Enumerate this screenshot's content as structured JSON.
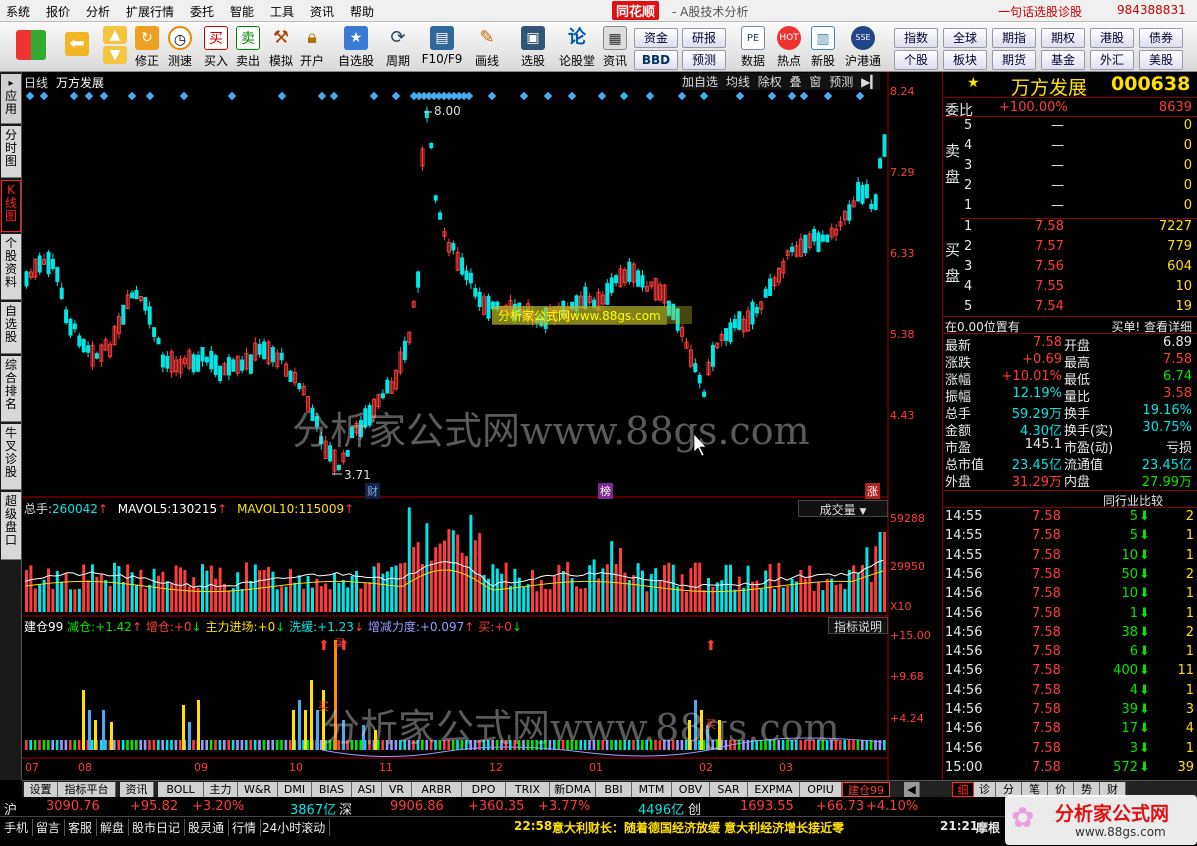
{
  "menubar": {
    "items": [
      "系统",
      "报价",
      "分析",
      "扩展行情",
      "委托",
      "智能",
      "工具",
      "资讯",
      "帮助"
    ],
    "logo": "同花顺",
    "subtitle": "- A股技术分析",
    "promo": "一句话选股诊股",
    "phone": "984388831"
  },
  "toolbar": {
    "buttons": [
      "修正",
      "测速",
      "买入",
      "卖出",
      "模拟",
      "开户",
      "自选股",
      "周期",
      "F10/F9",
      "画线",
      "选股",
      "论股堂",
      "资讯",
      "数据",
      "热点",
      "新股",
      "沪港通"
    ],
    "grid_buttons": [
      "资金",
      "研报",
      "BBD",
      "预测"
    ],
    "index_buttons": [
      "指数",
      "全球",
      "期指",
      "期权",
      "港股",
      "债券",
      "个股",
      "板块",
      "期货",
      "基金",
      "外汇",
      "美股"
    ]
  },
  "lefttabs": [
    "应用",
    "分时图",
    "K线图",
    "个股资料",
    "自选股",
    "综合排名",
    "牛叉诊股",
    "超级盘口"
  ],
  "kline": {
    "period": "日线",
    "name": "万方发展",
    "actions": [
      "加自选",
      "均线",
      "除权",
      "叠",
      "窗",
      "预测"
    ],
    "price_ticks": [
      "8.24",
      "7.29",
      "6.33",
      "5.38",
      "4.43"
    ],
    "high_label": "8.00",
    "low_label": "3.71",
    "markers": [
      "财",
      "榜",
      "涨"
    ],
    "watermark_small": "分析家公式网www.88gs.com",
    "watermark": "分析家公式网www.88gs.com"
  },
  "volume": {
    "label_total": "总手:",
    "total": "260042",
    "label_ma5": "MAVOL5:",
    "ma5": "130215",
    "label_ma10": "MAVOL10:",
    "ma10": "115009",
    "selector": "成交量",
    "ticks": [
      "59288",
      "29950",
      "X10"
    ]
  },
  "indicator": {
    "name": "建仓99",
    "items": [
      {
        "label": "减仓:",
        "value": "+1.42"
      },
      {
        "label": "增仓:",
        "value": "+0"
      },
      {
        "label": "主力进场:",
        "value": "+0"
      },
      {
        "label": "洗缓:",
        "value": "+1.23"
      },
      {
        "label": "增减力度:",
        "value": "+0.097"
      },
      {
        "label": "买:",
        "value": "+0"
      }
    ],
    "help": "指标说明",
    "ticks": [
      "+15.00",
      "+9.68",
      "+4.24"
    ],
    "buy_label": "买",
    "buy_label2": "买",
    "buy_label3": "买"
  },
  "xaxis": [
    "07",
    "08",
    "09",
    "10",
    "11",
    "12",
    "01",
    "02",
    "03"
  ],
  "bottomtabs": [
    "设置",
    "指标平台",
    "资讯",
    "BOLL",
    "主力",
    "W&R",
    "DMI",
    "BIAS",
    "ASI",
    "VR",
    "ARBR",
    "DPO",
    "TRIX",
    "新DMA",
    "BBI",
    "MTM",
    "OBV",
    "SAR",
    "EXPMA",
    "OPIU",
    "建仓99"
  ],
  "rightpanel": {
    "star": "★",
    "name": "万方发展",
    "code": "000638",
    "weibi_label": "委比",
    "weibi": "+100.00%",
    "weicha": "8639",
    "sell_label": "卖盘",
    "buy_label": "买盘",
    "sells": [
      {
        "lv": "5",
        "price": "—",
        "vol": "0"
      },
      {
        "lv": "4",
        "price": "—",
        "vol": "0"
      },
      {
        "lv": "3",
        "price": "—",
        "vol": "0"
      },
      {
        "lv": "2",
        "price": "—",
        "vol": "0"
      },
      {
        "lv": "1",
        "price": "—",
        "vol": "0"
      }
    ],
    "buys": [
      {
        "lv": "1",
        "price": "7.58",
        "vol": "7227"
      },
      {
        "lv": "2",
        "price": "7.57",
        "vol": "779"
      },
      {
        "lv": "3",
        "price": "7.56",
        "vol": "604"
      },
      {
        "lv": "4",
        "price": "7.55",
        "vol": "10"
      },
      {
        "lv": "5",
        "price": "7.54",
        "vol": "19"
      }
    ],
    "pos_text": "在0.00位置有",
    "pos_right": "买单! 查看详细",
    "stats": [
      {
        "l1": "最新",
        "v1": "7.58",
        "l2": "开盘",
        "v2": "6.89"
      },
      {
        "l1": "涨跌",
        "v1": "+0.69",
        "l2": "最高",
        "v2": "7.58"
      },
      {
        "l1": "涨幅",
        "v1": "+10.01%",
        "l2": "最低",
        "v2": "6.74"
      },
      {
        "l1": "振幅",
        "v1": "12.19%",
        "l2": "量比",
        "v2": "3.58"
      },
      {
        "l1": "总手",
        "v1": "59.29万",
        "l2": "换手",
        "v2": "19.16%"
      },
      {
        "l1": "金额",
        "v1": "4.30亿",
        "l2": "换手(实)",
        "v2": "30.75%"
      },
      {
        "l1": "市盈",
        "v1": "145.1",
        "l2": "市盈(动)",
        "v2": "亏损"
      },
      {
        "l1": "总市值",
        "v1": "23.45亿",
        "l2": "流通值",
        "v2": "23.45亿"
      },
      {
        "l1": "外盘",
        "v1": "31.29万",
        "l2": "内盘",
        "v2": "27.99万"
      }
    ],
    "peer": "同行业比较",
    "trades": [
      {
        "t": "14:55",
        "p": "7.58",
        "v": "5",
        "n": "2"
      },
      {
        "t": "14:55",
        "p": "7.58",
        "v": "5",
        "n": "1"
      },
      {
        "t": "14:55",
        "p": "7.58",
        "v": "10",
        "n": "1"
      },
      {
        "t": "14:56",
        "p": "7.58",
        "v": "50",
        "n": "2"
      },
      {
        "t": "14:56",
        "p": "7.58",
        "v": "10",
        "n": "1"
      },
      {
        "t": "14:56",
        "p": "7.58",
        "v": "1",
        "n": "1"
      },
      {
        "t": "14:56",
        "p": "7.58",
        "v": "38",
        "n": "2"
      },
      {
        "t": "14:56",
        "p": "7.58",
        "v": "6",
        "n": "1"
      },
      {
        "t": "14:56",
        "p": "7.58",
        "v": "400",
        "n": "11"
      },
      {
        "t": "14:56",
        "p": "7.58",
        "v": "4",
        "n": "1"
      },
      {
        "t": "14:56",
        "p": "7.58",
        "v": "39",
        "n": "3"
      },
      {
        "t": "14:56",
        "p": "7.58",
        "v": "17",
        "n": "4"
      },
      {
        "t": "14:56",
        "p": "7.58",
        "v": "3",
        "n": "1"
      },
      {
        "t": "15:00",
        "p": "7.58",
        "v": "572",
        "n": "39"
      }
    ],
    "tabs": [
      "细",
      "诊",
      "分",
      "笔",
      "价",
      "势",
      "财"
    ]
  },
  "statusbar": {
    "sh_label": "沪",
    "sh_idx": "3090.76",
    "sh_chg": "+95.82",
    "sh_pct": "+3.20%",
    "sh_amt": "3867亿",
    "sz_label": "深",
    "sz_idx": "9906.86",
    "sz_chg": "+360.35",
    "sz_pct": "+3.77%",
    "sz_amt": "4496亿",
    "cy_label": "创",
    "cy_idx": "1693.55",
    "cy_chg": "+66.73",
    "cy_pct": "+4.10%"
  },
  "bottomline": {
    "items": [
      "手机",
      "留言",
      "客服",
      "解盘",
      "股市日记",
      "股灵通",
      "行情",
      "24小时滚动"
    ],
    "news_time": "22:58",
    "news": "意大利财长：随着德国经济放缓 意大利经济增长接近零",
    "news2_time": "21:21",
    "news2": "摩根",
    "logo": "分析家公式网",
    "logo_url": "www.88gs.com"
  },
  "colors": {
    "up": "#ff3c3c",
    "down": "#00e6e6",
    "ma5": "#ffffff",
    "ma10": "#ffe000",
    "bg": "#000000"
  }
}
